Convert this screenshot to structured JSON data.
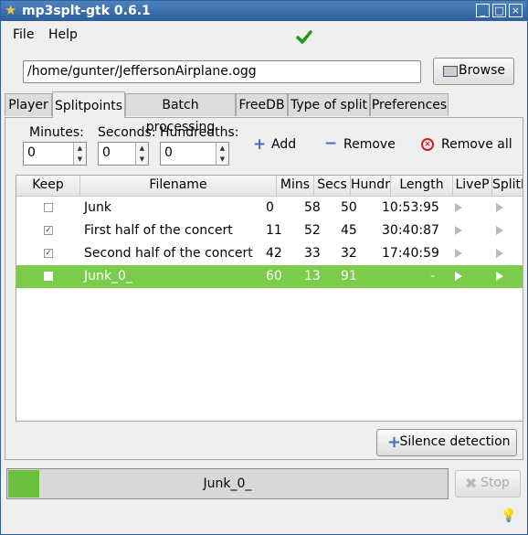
{
  "window": {
    "title": "mp3splt-gtk 0.6.1",
    "title_icon": "star-icon"
  },
  "menubar": {
    "file": "File",
    "help": "Help",
    "status_icon": "check-icon"
  },
  "file": {
    "path": "/home/gunter/JeffersonAirplane.ogg",
    "browse_label": "Browse"
  },
  "tabs": [
    "Player",
    "Splitpoints",
    "Batch processing",
    "FreeDB",
    "Type of split",
    "Preferences"
  ],
  "active_tab": "Splitpoints",
  "splitpoint_form": {
    "minutes_label": "Minutes:",
    "seconds_label": "Seconds:",
    "hundredths_label": "Hundredths:",
    "minutes": "0",
    "seconds": "0",
    "hundredths": "0",
    "add_label": "Add",
    "remove_label": "Remove",
    "remove_all_label": "Remove all"
  },
  "table": {
    "columns": [
      "Keep",
      "Filename",
      "Mins",
      "Secs",
      "Hundr",
      "Length",
      "LiveP",
      "SplitP"
    ],
    "rows": [
      {
        "keep": false,
        "filename": "Junk",
        "mins": "0",
        "secs": "58",
        "hundr": "50",
        "length": "10:53:95"
      },
      {
        "keep": true,
        "filename": "First half of the concert",
        "mins": "11",
        "secs": "52",
        "hundr": "45",
        "length": "30:40:87"
      },
      {
        "keep": true,
        "filename": "Second half of the concert",
        "mins": "42",
        "secs": "33",
        "hundr": "32",
        "length": "17:40:59"
      },
      {
        "keep": false,
        "filename": "Junk_0_",
        "mins": "60",
        "secs": "13",
        "hundr": "91",
        "length": "-",
        "selected": true
      }
    ]
  },
  "silence_label": "Silence detection",
  "progress": {
    "text": "Junk_0_",
    "value": 0.07
  },
  "stop_label": "Stop",
  "colors": {
    "selection": "#7bcc4a",
    "progress": "#6abf3d",
    "titlebar": "#2e5e9c"
  }
}
